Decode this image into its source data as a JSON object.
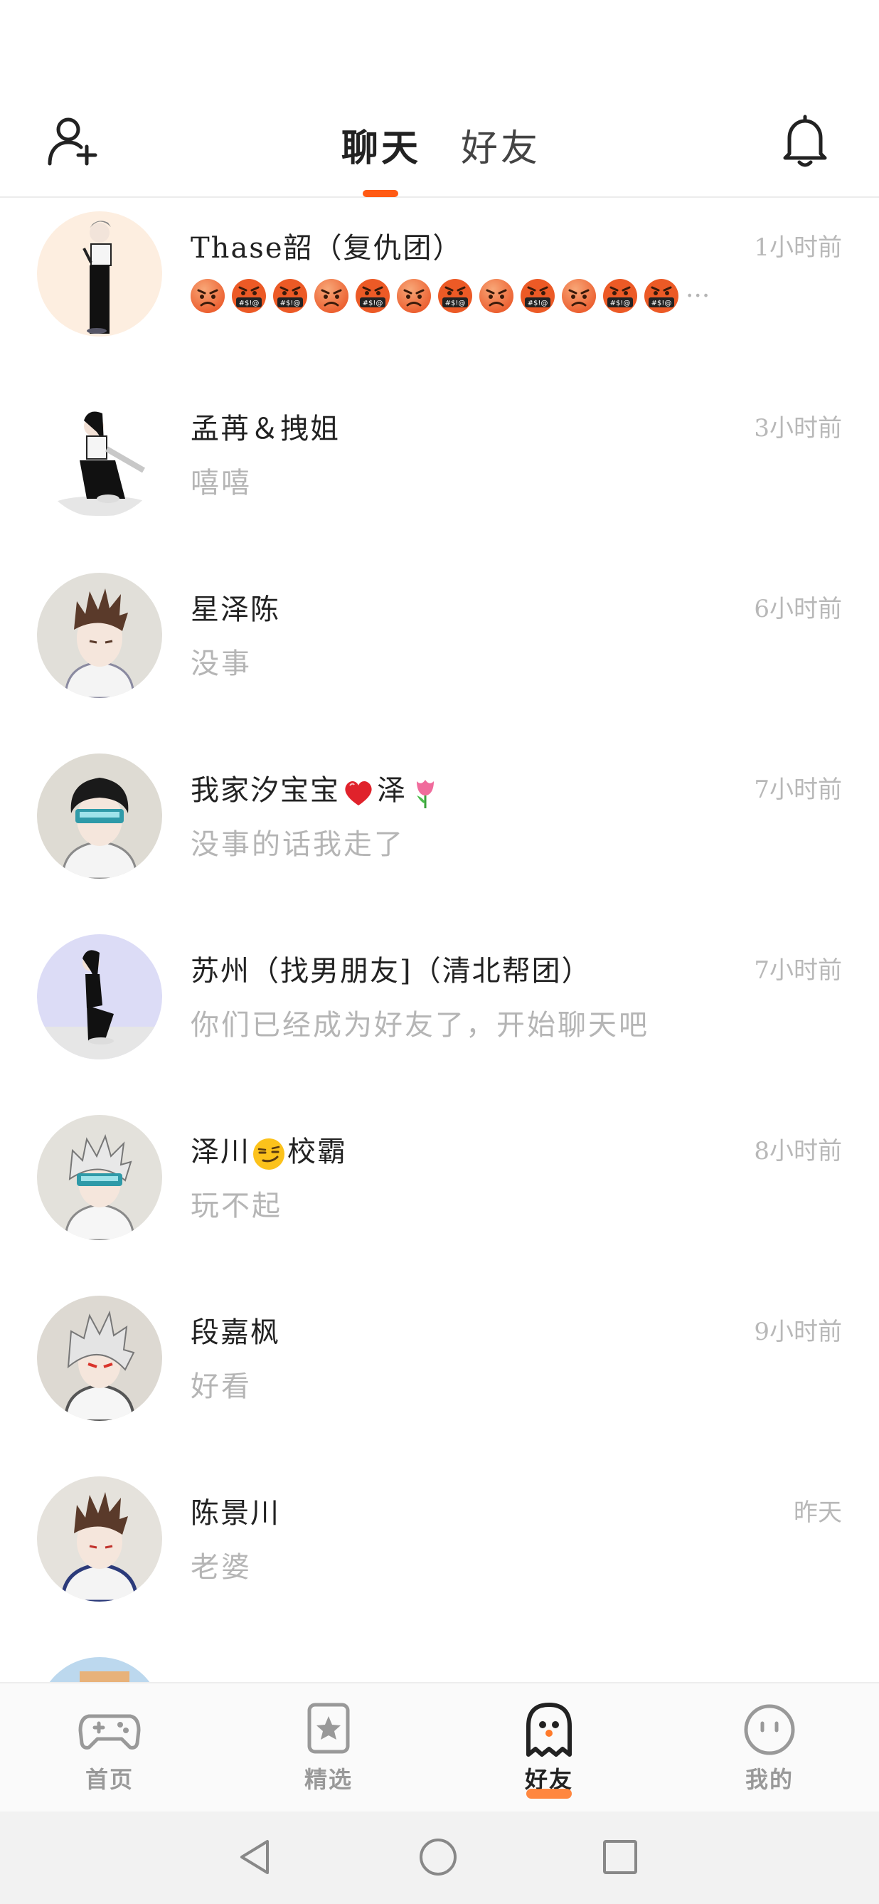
{
  "header": {
    "tabs": [
      {
        "label": "聊天",
        "active": true
      },
      {
        "label": "好友",
        "active": false
      }
    ],
    "icons": {
      "left": "add-friend-icon",
      "right": "bell-icon"
    },
    "accent_color": "#ff5a14"
  },
  "chats": [
    {
      "name": "Thase韶（复仇团）",
      "time": "1小时前",
      "message_emojis": [
        "angry-face",
        "cursing-face",
        "cursing-face",
        "angry-face",
        "cursing-face",
        "angry-face",
        "cursing-face",
        "angry-face",
        "cursing-face",
        "angry-face",
        "cursing-face",
        "cursing-face"
      ],
      "message_suffix": "···"
    },
    {
      "name": "孟苒＆拽姐",
      "time": "3小时前",
      "message": "嘻嘻"
    },
    {
      "name": "星泽陈",
      "time": "6小时前",
      "message": "没事"
    },
    {
      "name_prefix": "我家汐宝宝",
      "name_suffix": "泽",
      "name_emojis": [
        "red-heart",
        "tulip"
      ],
      "time": "7小时前",
      "message": "没事的话我走了"
    },
    {
      "name": "苏州（找男朋友]（清北帮团）",
      "time": "7小时前",
      "message": "你们已经成为好友了，开始聊天吧"
    },
    {
      "name_prefix": "泽川",
      "name_suffix": "校霸",
      "name_emojis": [
        "smirking-face"
      ],
      "time": "8小时前",
      "message": "玩不起"
    },
    {
      "name": "段嘉枫",
      "time": "9小时前",
      "message": "好看"
    },
    {
      "name": "陈景川",
      "time": "昨天",
      "message": "老婆"
    }
  ],
  "bottom_nav": [
    {
      "label": "首页",
      "icon": "gamepad-icon",
      "active": false
    },
    {
      "label": "精选",
      "icon": "star-bookmark-icon",
      "active": false
    },
    {
      "label": "好友",
      "icon": "ghost-icon",
      "active": true
    },
    {
      "label": "我的",
      "icon": "smiley-icon",
      "active": false
    }
  ],
  "system_nav": [
    "back-icon",
    "home-icon",
    "recents-icon"
  ]
}
